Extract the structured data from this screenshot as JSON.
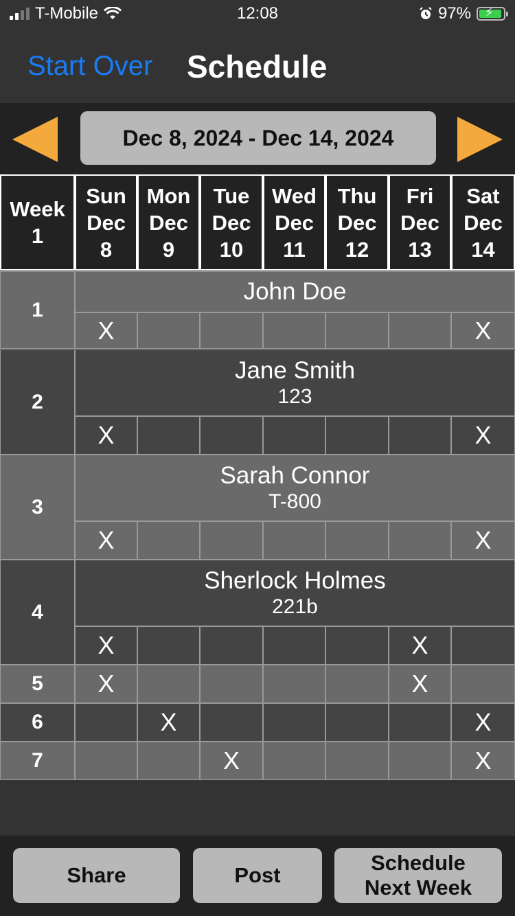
{
  "status": {
    "carrier": "T-Mobile",
    "time": "12:08",
    "battery": "97%"
  },
  "nav": {
    "back_label": "Start Over",
    "title": "Schedule"
  },
  "week": {
    "range": "Dec 8, 2024 - Dec 14, 2024"
  },
  "header": {
    "week_label": "Week",
    "week_num": "1",
    "days": [
      {
        "dow": "Sun",
        "mon": "Dec",
        "day": "8"
      },
      {
        "dow": "Mon",
        "mon": "Dec",
        "day": "9"
      },
      {
        "dow": "Tue",
        "mon": "Dec",
        "day": "10"
      },
      {
        "dow": "Wed",
        "mon": "Dec",
        "day": "11"
      },
      {
        "dow": "Thu",
        "mon": "Dec",
        "day": "12"
      },
      {
        "dow": "Fri",
        "mon": "Dec",
        "day": "13"
      },
      {
        "dow": "Sat",
        "mon": "Dec",
        "day": "14"
      }
    ]
  },
  "mark_symbol": "X",
  "rows": [
    {
      "num": "1",
      "name": "John Doe",
      "sub": "",
      "marks": [
        true,
        false,
        false,
        false,
        false,
        false,
        true
      ]
    },
    {
      "num": "2",
      "name": "Jane Smith",
      "sub": "123",
      "marks": [
        true,
        false,
        false,
        false,
        false,
        false,
        true
      ]
    },
    {
      "num": "3",
      "name": "Sarah Connor",
      "sub": "T-800",
      "marks": [
        true,
        false,
        false,
        false,
        false,
        false,
        true
      ]
    },
    {
      "num": "4",
      "name": "Sherlock Holmes",
      "sub": "221b",
      "marks": [
        true,
        false,
        false,
        false,
        false,
        true,
        false
      ]
    },
    {
      "num": "5",
      "name": "",
      "sub": "",
      "marks": [
        true,
        false,
        false,
        false,
        false,
        true,
        false
      ]
    },
    {
      "num": "6",
      "name": "",
      "sub": "",
      "marks": [
        false,
        true,
        false,
        false,
        false,
        false,
        true
      ]
    },
    {
      "num": "7",
      "name": "",
      "sub": "",
      "marks": [
        false,
        false,
        true,
        false,
        false,
        false,
        true
      ]
    }
  ],
  "footer": {
    "share_label": "Share",
    "post_label": "Post",
    "next_line1": "Schedule",
    "next_line2": "Next Week"
  },
  "colors": {
    "accent_blue": "#1a7cf5",
    "arrow_orange": "#f3a93c",
    "row_light": "#6a6a6a",
    "row_dark": "#444444"
  }
}
